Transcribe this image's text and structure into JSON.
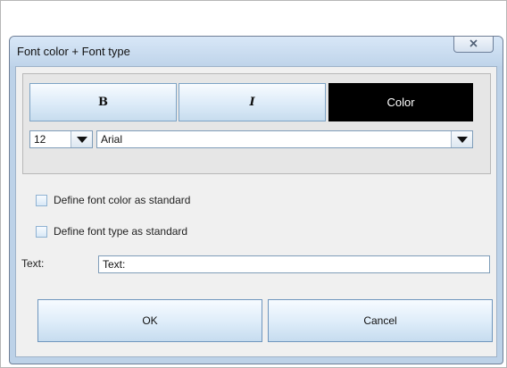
{
  "dialog": {
    "title": "Font color + Font type",
    "close_icon": "close-icon"
  },
  "format_buttons": {
    "bold_label": "B",
    "italic_label": "I",
    "color_label": "Color",
    "color_swatch": "#000000"
  },
  "font": {
    "size_value": "12",
    "family_value": "Arial",
    "dropdown_icon": "chevron-down-icon"
  },
  "options": {
    "font_color_standard_label": "Define font color as standard",
    "font_type_standard_label": "Define font type as standard",
    "font_color_standard_checked": false,
    "font_type_standard_checked": false
  },
  "text_field": {
    "label": "Text:",
    "value": "Text:"
  },
  "actions": {
    "ok_label": "OK",
    "cancel_label": "Cancel"
  }
}
